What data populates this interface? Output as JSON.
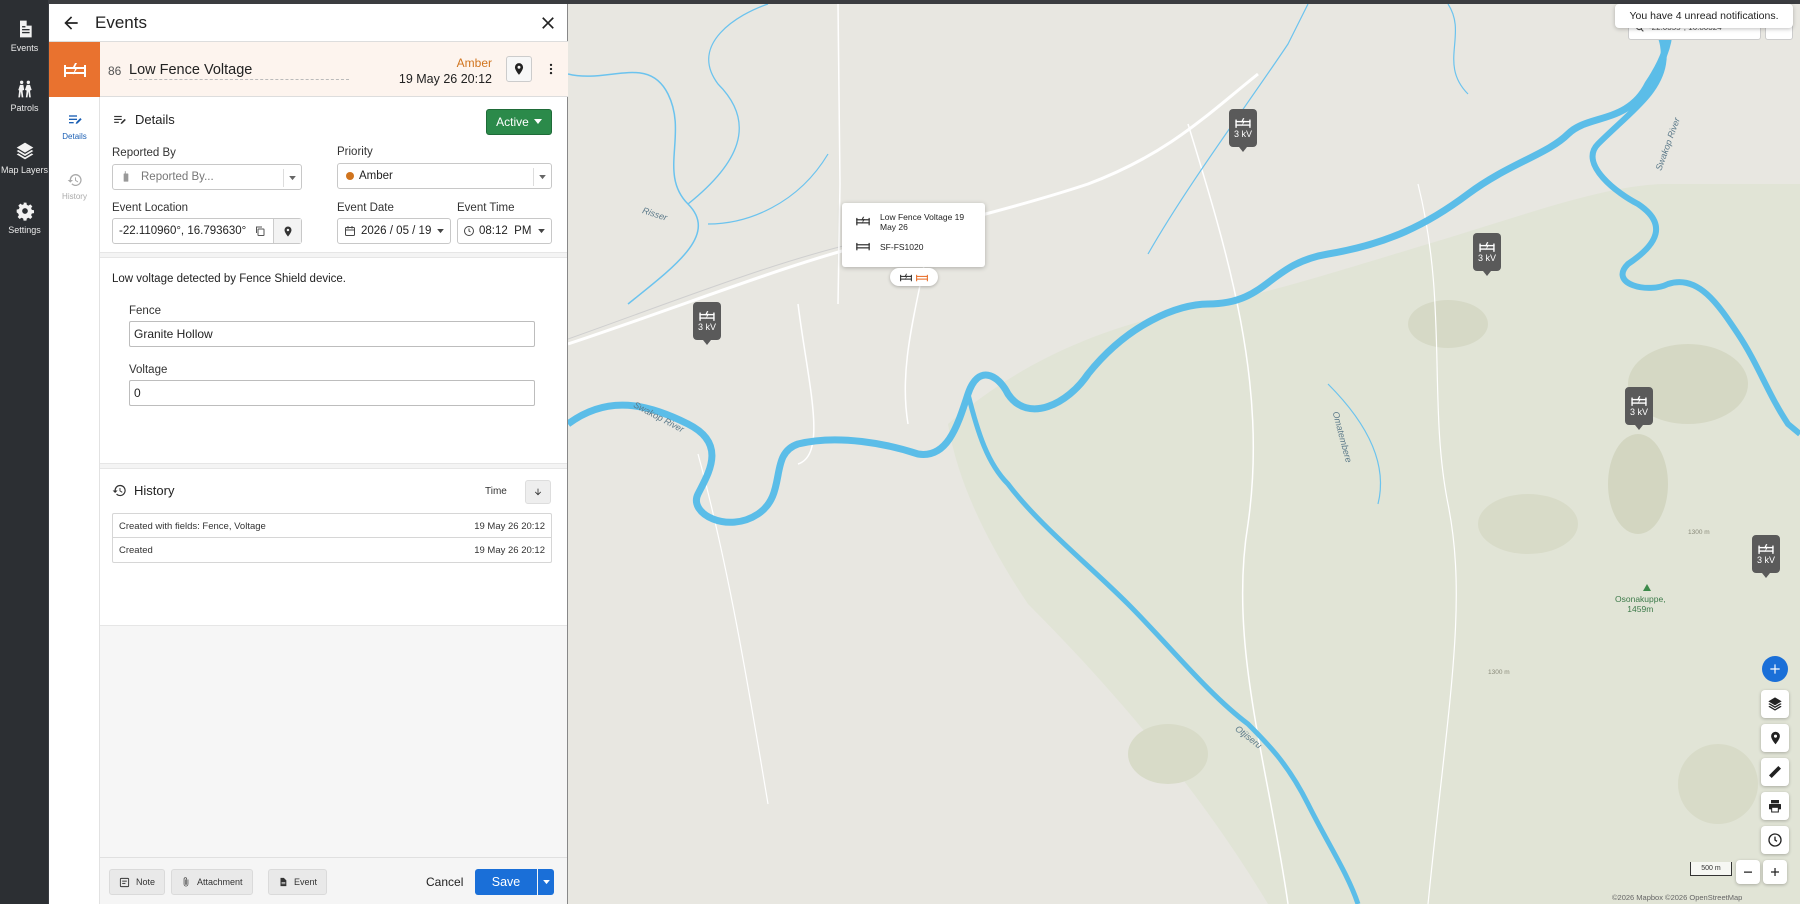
{
  "nav": {
    "items": [
      {
        "label": "Events",
        "icon": "document-icon"
      },
      {
        "label": "Patrols",
        "icon": "patrols-icon"
      },
      {
        "label": "Map Layers",
        "icon": "layers-icon"
      },
      {
        "label": "Settings",
        "icon": "gear-icon"
      }
    ]
  },
  "drawer": {
    "title": "Events"
  },
  "event": {
    "serial": "86",
    "title": "Low Fence Voltage",
    "priority_text": "Amber",
    "datetime": "19 May 26 20:12",
    "type_color": "#e9722f"
  },
  "tabs": [
    {
      "label": "Details",
      "active": true
    },
    {
      "label": "History",
      "active": false
    }
  ],
  "details": {
    "section_title": "Details",
    "status_button": "Active",
    "reported_by_label": "Reported By",
    "reported_by_placeholder": "Reported By...",
    "priority_label": "Priority",
    "priority_value": "Amber",
    "priority_color": "#d0741e",
    "location_label": "Event Location",
    "location_value": "-22.110960°, 16.793630°",
    "date_label": "Event Date",
    "date_value": "2026 / 05 / 19",
    "time_label": "Event Time",
    "time_value": "08:12  PM",
    "description": "Low voltage detected by Fence Shield device.",
    "fence_label": "Fence",
    "fence_value": "Granite Hollow",
    "voltage_label": "Voltage",
    "voltage_value": "0"
  },
  "history": {
    "section_title": "History",
    "sort_label": "Time",
    "rows": [
      {
        "message": "Created with fields: Fence, Voltage",
        "time": "19 May 26 20:12"
      },
      {
        "message": "Created",
        "time": "19 May 26 20:12"
      }
    ]
  },
  "footer": {
    "note": "Note",
    "attachment": "Attachment",
    "event": "Event",
    "cancel": "Cancel",
    "save": "Save"
  },
  "map": {
    "notification": "You have 4 unread notifications.",
    "search_fragment": "-22.0355°, 16.80324",
    "popup_title": "Low Fence Voltage 19 May 26",
    "popup_device": "SF-FS1020",
    "marker_label": "3 kV",
    "scale": "500 m",
    "attribution": "©2026 Mapbox ©2026 OpenStreetMap",
    "river_color": "#5bbde8",
    "labels": {
      "risser": "Risser",
      "swakop_left": "Swakop River",
      "swakop_right": "Swakop River",
      "omatembere": "Omatembere",
      "otjiseru": "Otjiseru",
      "peak": "Osonakuppe,\n1459m",
      "contour_1": "1300 m",
      "contour_2": "1300 m"
    }
  }
}
